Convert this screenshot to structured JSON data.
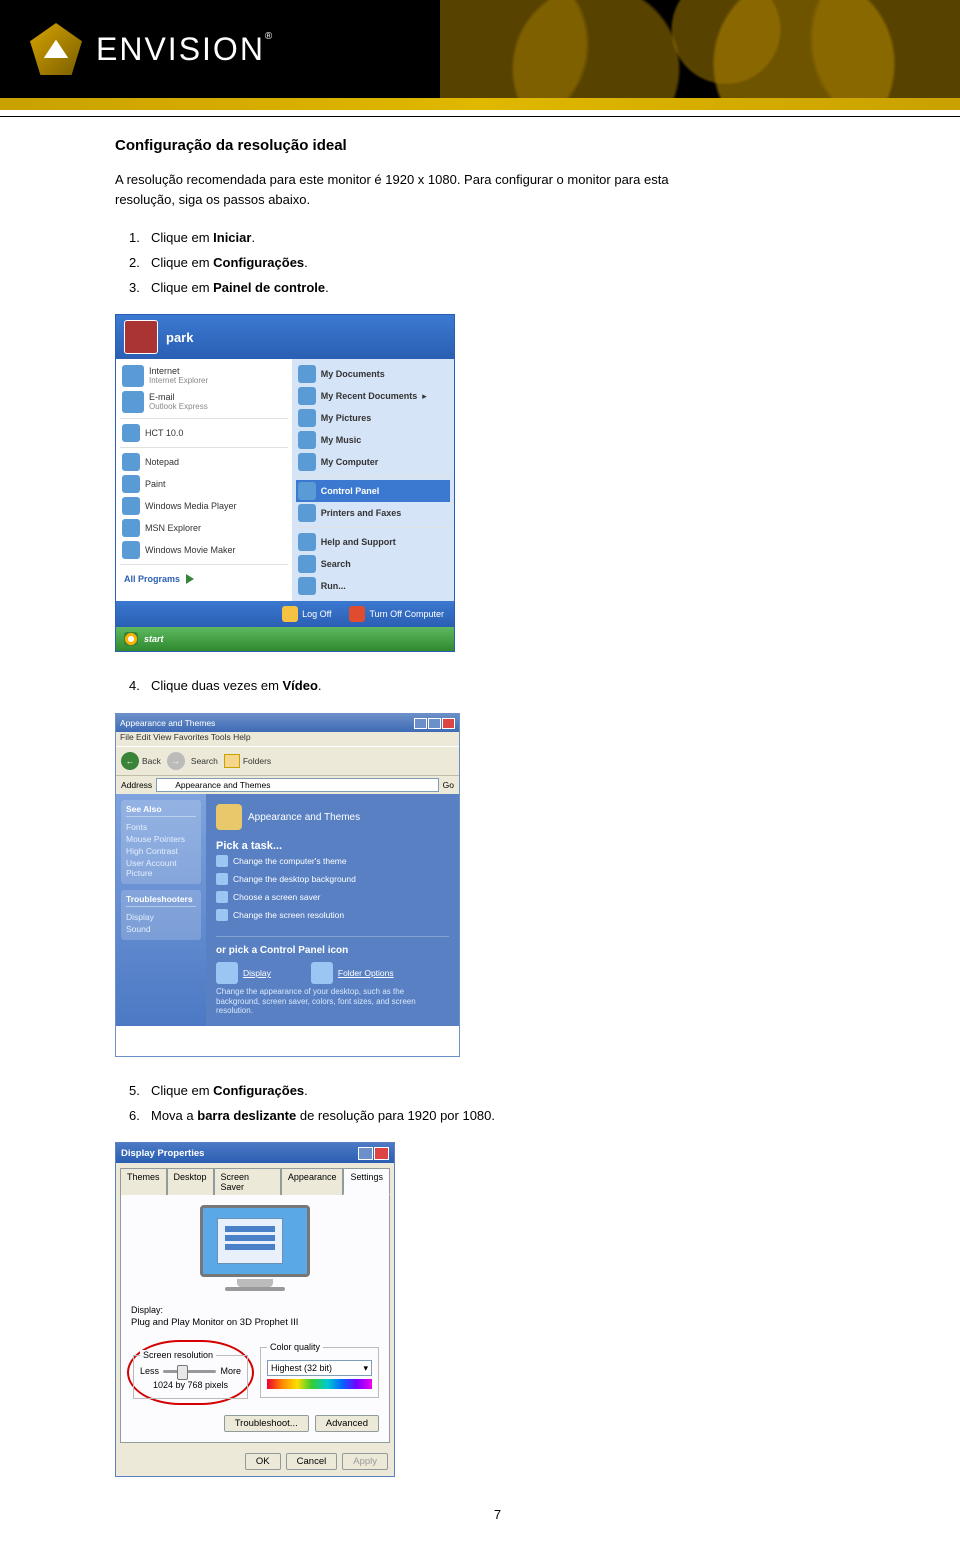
{
  "brand": {
    "name": "ENVISION"
  },
  "section_title": "Configuração da resolução ideal",
  "intro": "A resolução recomendada para este monitor é 1920 x 1080. Para configurar o monitor para esta resolução, siga os passos abaixo.",
  "steps_a": [
    {
      "num": "1.",
      "prefix": "Clique em ",
      "bold": "Iniciar",
      "suffix": "."
    },
    {
      "num": "2.",
      "prefix": "Clique em ",
      "bold": "Configurações",
      "suffix": "."
    },
    {
      "num": "3.",
      "prefix": "Clique em ",
      "bold": "Painel de controle",
      "suffix": "."
    }
  ],
  "steps_b": [
    {
      "num": "4.",
      "prefix": "Clique duas vezes em ",
      "bold": "Vídeo",
      "suffix": "."
    }
  ],
  "steps_c": [
    {
      "num": "5.",
      "prefix": "Clique em ",
      "bold": "Configurações",
      "suffix": "."
    },
    {
      "num": "6.",
      "prefix": "Mova a ",
      "bold": "barra deslizante",
      "suffix": " de resolução para 1920 por 1080."
    }
  ],
  "start_menu": {
    "username": "park",
    "left": [
      {
        "title": "Internet",
        "sub": "Internet Explorer"
      },
      {
        "title": "E-mail",
        "sub": "Outlook Express"
      },
      {
        "title": "HCT 10.0",
        "sub": null
      },
      {
        "title": "Notepad",
        "sub": null
      },
      {
        "title": "Paint",
        "sub": null
      },
      {
        "title": "Windows Media Player",
        "sub": null
      },
      {
        "title": "MSN Explorer",
        "sub": null
      },
      {
        "title": "Windows Movie Maker",
        "sub": null
      }
    ],
    "all_programs": "All Programs",
    "right": [
      {
        "title": "My Documents",
        "sel": false
      },
      {
        "title": "My Recent Documents",
        "sel": false,
        "arrow": true
      },
      {
        "title": "My Pictures",
        "sel": false
      },
      {
        "title": "My Music",
        "sel": false
      },
      {
        "title": "My Computer",
        "sel": false
      },
      {
        "title": "Control Panel",
        "sel": true
      },
      {
        "title": "Printers and Faxes",
        "sel": false
      },
      {
        "title": "Help and Support",
        "sel": false
      },
      {
        "title": "Search",
        "sel": false
      },
      {
        "title": "Run...",
        "sel": false
      }
    ],
    "logoff": "Log Off",
    "turnoff": "Turn Off Computer",
    "start": "start"
  },
  "control_panel": {
    "title": "Appearance and Themes",
    "menu": "File   Edit   View   Favorites   Tools   Help",
    "back": "Back",
    "search": "Search",
    "folders_lbl": "Folders",
    "address_lbl": "Address",
    "address_val": "Appearance and Themes",
    "go": "Go",
    "side": {
      "panel1_title": "See Also",
      "panel1_items": [
        "Fonts",
        "Mouse Pointers",
        "High Contrast",
        "User Account Picture"
      ],
      "panel2_title": "Troubleshooters",
      "panel2_items": [
        "Display",
        "Sound"
      ]
    },
    "main": {
      "header": "Appearance and Themes",
      "pick": "Pick a task...",
      "tasks": [
        "Change the computer's theme",
        "Change the desktop background",
        "Choose a screen saver",
        "Change the screen resolution"
      ],
      "orpick": "or pick a Control Panel icon",
      "icons": [
        {
          "label": "Display"
        },
        {
          "label": "Folder Options"
        }
      ],
      "note": "Change the appearance of your desktop, such as the background, screen saver, colors, font sizes, and screen resolution."
    }
  },
  "display_props": {
    "title": "Display Properties",
    "tabs": [
      "Themes",
      "Desktop",
      "Screen Saver",
      "Appearance",
      "Settings"
    ],
    "active_tab": 4,
    "display_label": "Display:",
    "display_value": "Plug and Play Monitor on 3D Prophet III",
    "res_group": "Screen resolution",
    "less": "Less",
    "more": "More",
    "res_value": "1024 by 768 pixels",
    "cq_group": "Color quality",
    "cq_value": "Highest (32 bit)",
    "troubleshoot": "Troubleshoot...",
    "advanced": "Advanced",
    "ok": "OK",
    "cancel": "Cancel",
    "apply": "Apply"
  },
  "page_number": "7"
}
